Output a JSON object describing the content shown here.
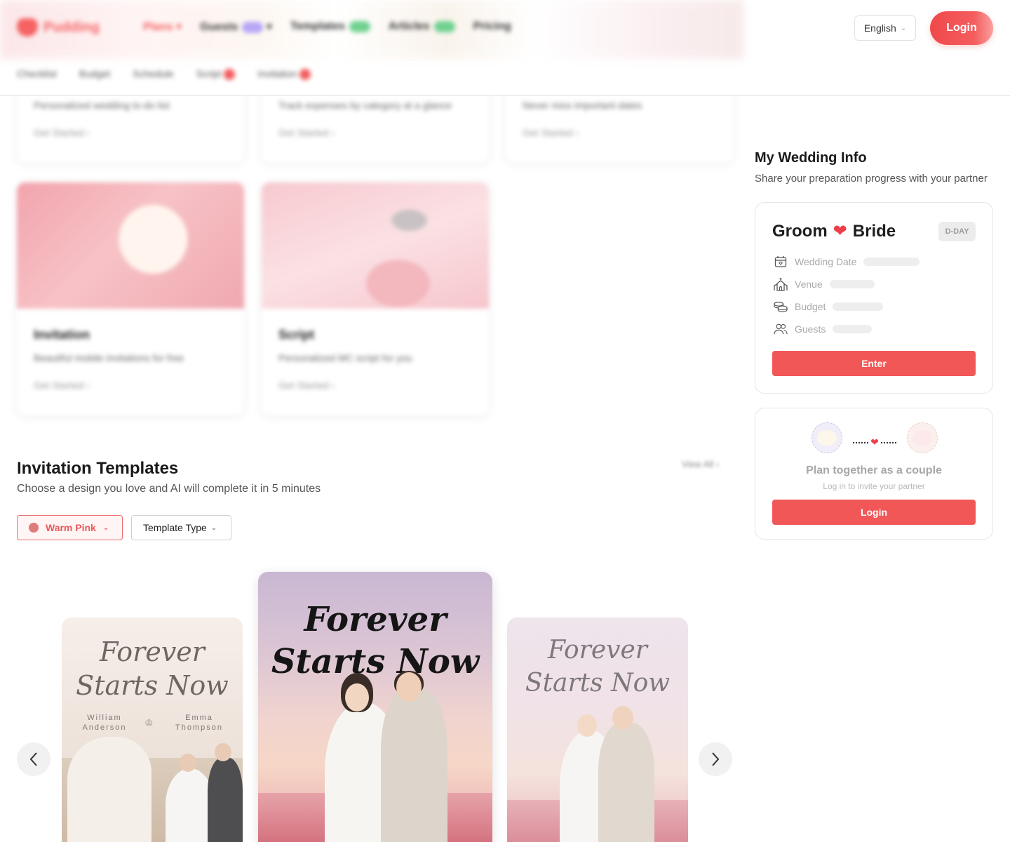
{
  "header": {
    "logo_text": "Pudding",
    "nav": [
      "Plans",
      "Guests",
      "Templates",
      "Articles",
      "Pricing"
    ],
    "subnav": [
      "Checklist",
      "Budget",
      "Schedule",
      "Script",
      "Invitation"
    ],
    "language": "English",
    "login_label": "Login"
  },
  "features": {
    "row1": [
      {
        "desc": "Personalized wedding to-do list",
        "cta": "Get Started"
      },
      {
        "desc": "Track expenses by category at a glance",
        "cta": "Get Started"
      },
      {
        "desc": "Never miss important dates",
        "cta": "Get Started"
      }
    ],
    "row2": [
      {
        "title": "Invitation",
        "desc": "Beautiful mobile invitations for free",
        "cta": "Get Started"
      },
      {
        "title": "Script",
        "desc": "Personalized MC script for you",
        "cta": "Get Started"
      }
    ]
  },
  "templates": {
    "title": "Invitation Templates",
    "subtitle": "Choose a design you love and AI will complete it in 5 minutes",
    "view_all": "View All",
    "filter_color": "Warm Pink",
    "filter_type": "Template Type",
    "cards": [
      {
        "script": "Forever Starts Now",
        "name_left": "William Anderson",
        "name_right": "Emma Thompson"
      },
      {
        "script": "Forever Starts Now"
      },
      {
        "script": "Forever Starts Now"
      }
    ]
  },
  "sidebar": {
    "title": "My Wedding Info",
    "subtitle": "Share your preparation progress with your partner",
    "groom": "Groom",
    "bride": "Bride",
    "dday": "D-DAY",
    "rows": [
      "Wedding Date",
      "Venue",
      "Budget",
      "Guests"
    ],
    "enter_label": "Enter",
    "couple_title": "Plan together as a couple",
    "couple_sub": "Log in to invite your partner",
    "login_label": "Login"
  },
  "colors": {
    "accent": "#f25757",
    "brand": "#f56363"
  }
}
